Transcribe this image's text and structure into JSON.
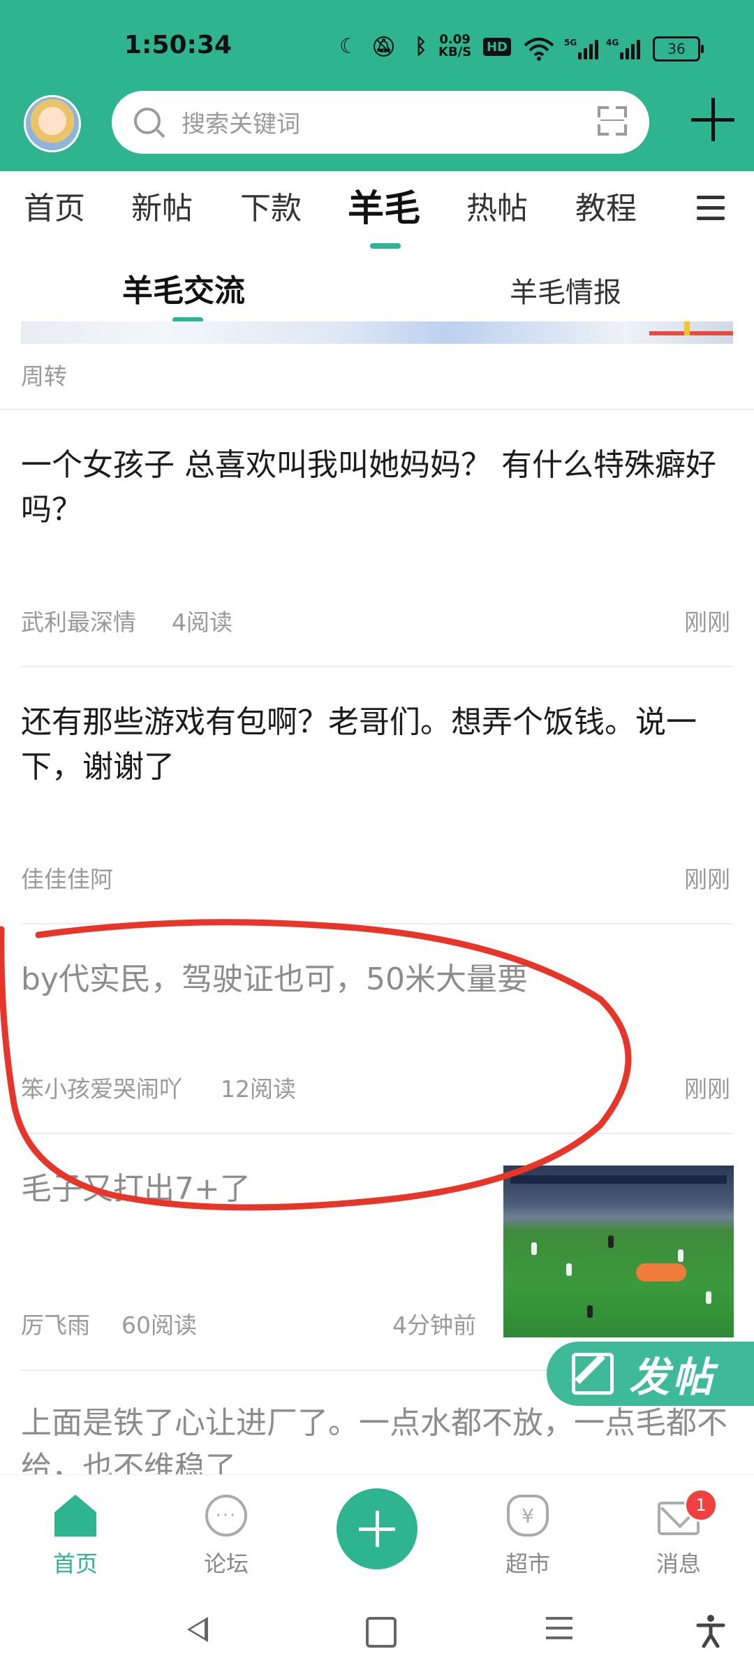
{
  "status_bar": {
    "time": "1:50:34",
    "net_speed": "0.09\nKB/S",
    "battery": "36",
    "icons": [
      "moon-icon",
      "silent-icon",
      "bluetooth-icon",
      "hd-icon",
      "wifi-icon",
      "5g-signal-icon",
      "4g-signal-icon",
      "battery-icon"
    ]
  },
  "header": {
    "search_placeholder": "搜索关键词",
    "colors": {
      "brand": "#2fb490"
    }
  },
  "main_tabs": [
    "首页",
    "新帖",
    "下款",
    "羊毛",
    "热帖",
    "教程"
  ],
  "active_main_tab": "羊毛",
  "sub_tabs": [
    "羊毛交流",
    "羊毛情报"
  ],
  "active_sub_tab": "羊毛交流",
  "feed": {
    "cut_post_author": "周转",
    "posts": [
      {
        "title": "一个女孩子 总喜欢叫我叫她妈妈？ 有什么特殊癖好吗？",
        "author": "武利最深情",
        "reads": "4阅读",
        "time": "刚刚"
      },
      {
        "title": "还有那些游戏有包啊？老哥们。想弄个饭钱。说一下，谢谢了",
        "author": "佳佳佳阿",
        "reads": "",
        "time": "刚刚"
      },
      {
        "title": "by代实民，驾驶证也可，50米大量要",
        "author": "笨小孩爱哭闹吖",
        "reads": "12阅读",
        "time": "刚刚"
      },
      {
        "title": "毛子又打出7+了",
        "author": "厉飞雨",
        "reads": "60阅读",
        "time": "4分钟前"
      },
      {
        "title": "上面是铁了心让进厂了。一点水都不放，一点毛都不给，也不维稳了"
      }
    ]
  },
  "fab": {
    "label": "发帖"
  },
  "bottom_nav": {
    "items": [
      {
        "label": "首页",
        "icon": "home-icon"
      },
      {
        "label": "论坛",
        "icon": "chat-bubble-icon"
      },
      {
        "label": "",
        "icon": "add-icon"
      },
      {
        "label": "超市",
        "icon": "money-bag-icon"
      },
      {
        "label": "消息",
        "icon": "mail-icon"
      }
    ],
    "unread_count": "1"
  }
}
